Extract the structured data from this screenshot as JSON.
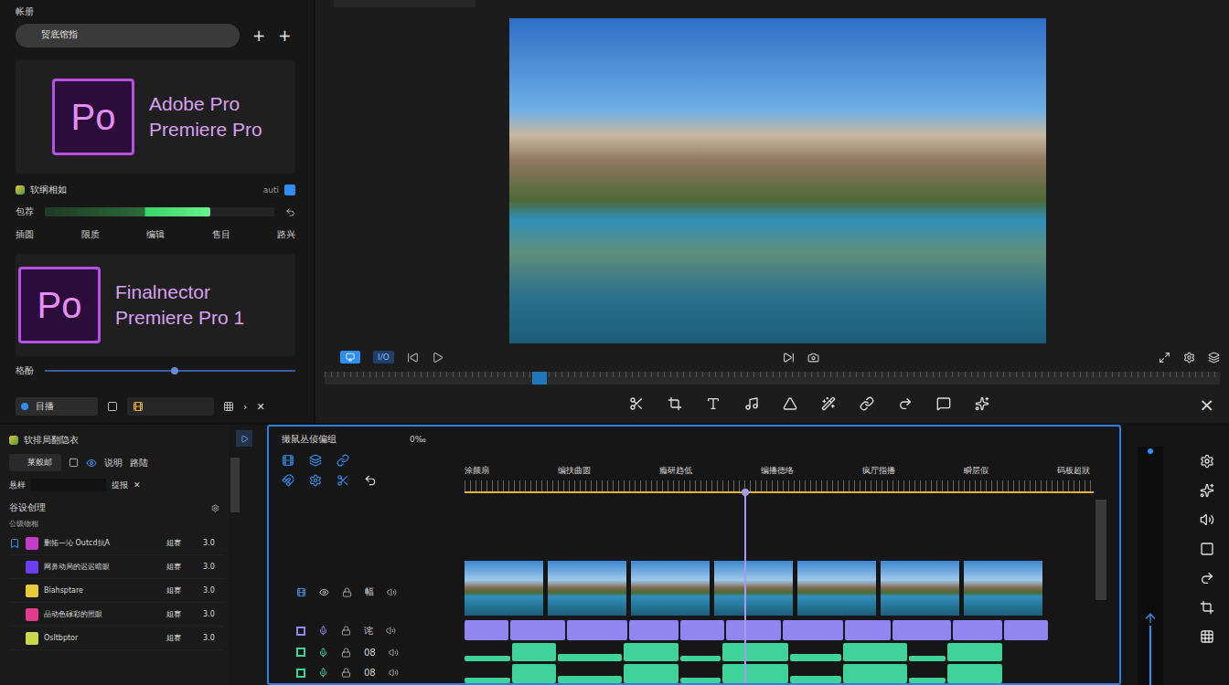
{
  "library": {
    "title": "帐册",
    "search": "贸底馆指",
    "add_buttons": [
      "+",
      "+"
    ],
    "cards": [
      {
        "logo": "Po",
        "title": "Adobe Pro",
        "subtitle": "Premiere Pro"
      },
      {
        "logo": "Po",
        "title": "Finalnector",
        "subtitle": "Premiere Pro 1"
      }
    ],
    "info_row": {
      "label": "软纲相如",
      "value": "auti"
    },
    "progress": {
      "label": "包荐",
      "level": 0.72
    },
    "tags": [
      "插圆",
      "限质",
      "编辑",
      "售目",
      "路兴"
    ],
    "slider": {
      "label": "格酚",
      "level": 0.52
    },
    "footer": {
      "primary": "目播",
      "chevron": "›",
      "close": "✕"
    }
  },
  "preview": {
    "io_label": "I/O",
    "scrubber_level": 0.24,
    "close": "×"
  },
  "project": {
    "title": "软排局翻隐衣",
    "chip": "莱般邮",
    "labels": [
      "说明",
      "路陆"
    ],
    "filter_label": "悬样",
    "filter_button": "提报",
    "filter_close": "✕",
    "section": "谷设创理",
    "subheader": "公级物相",
    "items": [
      {
        "name": "删拓—沁 Outcd抗A",
        "type": "姐赛",
        "value": "3.0",
        "color": "#c23cc9",
        "selected": true
      },
      {
        "name": "网鼻动局的迟迟暗眼",
        "type": "姐赛",
        "value": "3.0",
        "color": "#6a3ff0",
        "selected": false
      },
      {
        "name": "Biahsptare",
        "type": "姐赛",
        "value": "3.0",
        "color": "#e8c93a",
        "selected": false
      },
      {
        "name": "品动色碌彩的照眼",
        "type": "姐赛",
        "value": "3.0",
        "color": "#e23c8c",
        "selected": false
      },
      {
        "name": "Osltbptor",
        "type": "姐赛",
        "value": "3.0",
        "color": "#c8d84a",
        "selected": false
      }
    ]
  },
  "timeline": {
    "title": "撮鼠丛侦偏组",
    "badge": "0‰",
    "ruler": [
      "涂颜扇",
      "编扶曲圆",
      "瘾研趋低",
      "编播德络",
      "疯厅指播",
      "瞬层假",
      "码板超狀"
    ],
    "playhead_level": 0.45,
    "thumbnails": 7,
    "tracks": [
      {
        "kind": "video",
        "label": "幅",
        "color": "#4a90d9"
      },
      {
        "kind": "audio",
        "label": "诧",
        "color": "#8f86f0"
      },
      {
        "kind": "audio",
        "label": "08",
        "color": "#3fd39a"
      },
      {
        "kind": "audio",
        "label": "08",
        "color": "#3fd39a"
      }
    ]
  },
  "meter": {
    "level": 0.25
  }
}
